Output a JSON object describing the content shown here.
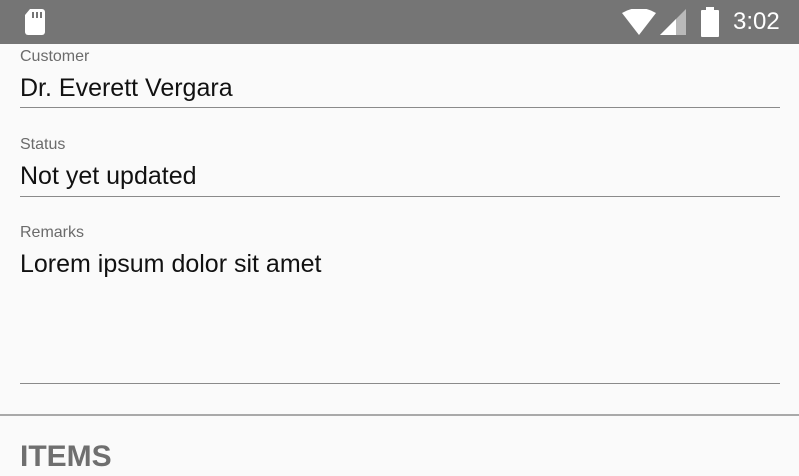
{
  "status_bar": {
    "time": "3:02",
    "icons": {
      "left": "sd-card-icon",
      "wifi": "wifi-icon",
      "signal": "cell-signal-icon",
      "battery": "battery-icon"
    },
    "background": "#757575"
  },
  "form": {
    "customer": {
      "label": "Customer",
      "value": "Dr. Everett Vergara"
    },
    "status": {
      "label": "Status",
      "value": "Not yet updated"
    },
    "remarks": {
      "label": "Remarks",
      "value": "Lorem ipsum dolor sit amet"
    }
  },
  "items_section": {
    "heading": "ITEMS"
  },
  "colors": {
    "background": "#fafafa",
    "label": "#6b6b6b",
    "value": "#111111",
    "underline": "#8a8a8a",
    "heading": "#6f6f6f"
  }
}
